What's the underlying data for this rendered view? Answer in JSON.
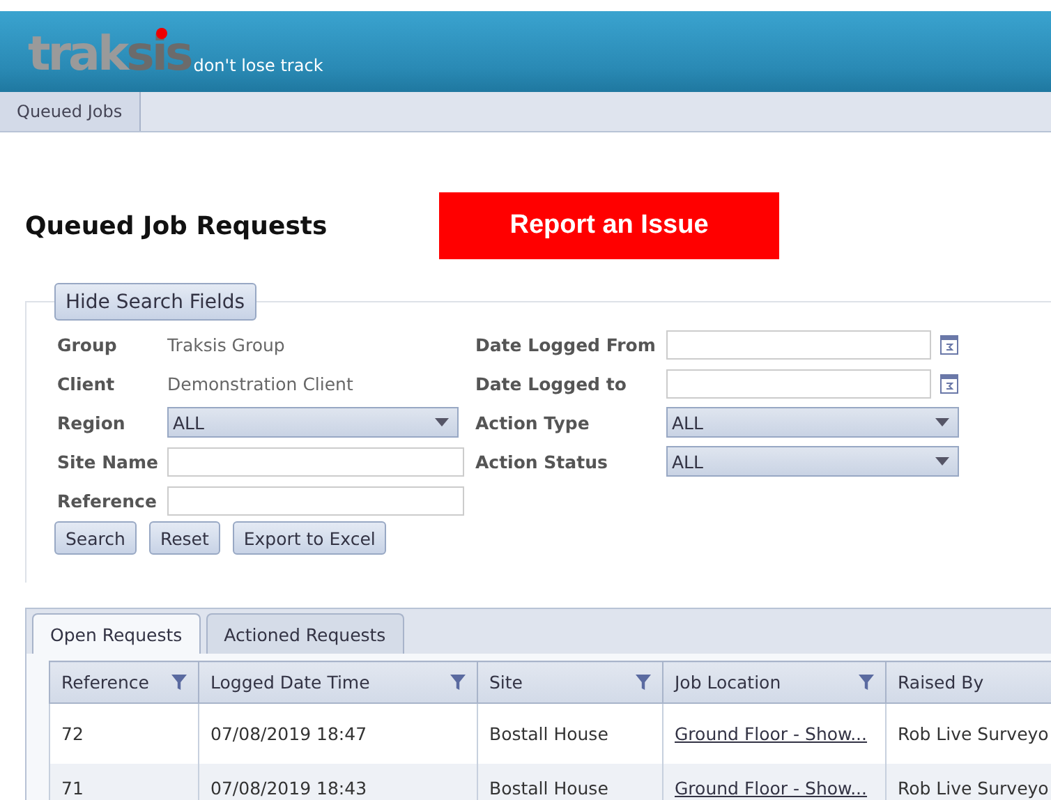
{
  "header": {
    "logo_main": "trak",
    "logo_accent": "sis",
    "tagline": "don't lose track"
  },
  "nav": [
    {
      "label": "Queued Jobs",
      "selected": true
    }
  ],
  "page_title": "Queued Job Requests",
  "report_button": "Report an Issue",
  "search": {
    "toggle": "Hide Search Fields",
    "left": [
      {
        "kind": "text",
        "label": "Group",
        "value": "Traksis Group"
      },
      {
        "kind": "text",
        "label": "Client",
        "value": "Demonstration Client"
      },
      {
        "kind": "select",
        "label": "Region",
        "value": "ALL"
      },
      {
        "kind": "input",
        "label": "Site Name"
      },
      {
        "kind": "input",
        "label": "Reference"
      }
    ],
    "right": [
      {
        "kind": "date",
        "label": "Date Logged From"
      },
      {
        "kind": "date",
        "label": "Date Logged to"
      },
      {
        "kind": "select",
        "label": "Action Type",
        "value": "ALL"
      },
      {
        "kind": "select",
        "label": "Action Status",
        "value": "ALL"
      }
    ],
    "buttons": [
      "Search",
      "Reset",
      "Export to Excel"
    ]
  },
  "tabs": [
    {
      "label": "Open Requests",
      "selected": true
    },
    {
      "label": "Actioned Requests",
      "selected": false
    }
  ],
  "table": {
    "columns": [
      "Reference",
      "Logged Date Time",
      "Site",
      "Job Location",
      "Raised By"
    ],
    "rows": [
      [
        "72",
        "07/08/2019 18:47",
        "Bostall House",
        "Ground Floor - Show...",
        "Rob Live Surveyo"
      ],
      [
        "71",
        "07/08/2019 18:43",
        "Bostall House",
        "Ground Floor - Show...",
        "Rob Live Surveyo"
      ]
    ]
  }
}
